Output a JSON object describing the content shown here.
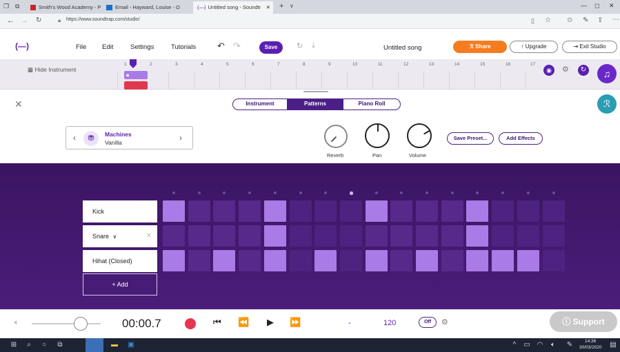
{
  "browser": {
    "tabs": [
      {
        "label": "Smith's Wood Academy - P"
      },
      {
        "label": "Email - Hayward, Louise - O"
      },
      {
        "label": "Untitled song - Soundtr"
      }
    ],
    "url": "https://www.soundtrap.com/studio/"
  },
  "header": {
    "menu": [
      "File",
      "Edit",
      "Settings",
      "Tutorials"
    ],
    "save": "Save",
    "song_title": "Untitled song",
    "share": "Share",
    "upgrade": "Upgrade",
    "exit": "Exit Studio"
  },
  "timeline": {
    "hide_instrument": "Hide Instrument",
    "ticks": [
      "1",
      "2",
      "3",
      "4",
      "5",
      "6",
      "7",
      "8",
      "9",
      "10",
      "11",
      "12",
      "13",
      "14",
      "15",
      "16",
      "17"
    ]
  },
  "editor": {
    "tabs": [
      "Instrument",
      "Patterns",
      "Piano Roll"
    ],
    "active_tab": "Patterns",
    "instrument_name": "Machines",
    "instrument_preset": "Vanilla",
    "knobs": [
      "Reverb",
      "Pan",
      "Volume"
    ],
    "save_preset": "Save Preset...",
    "add_effects": "Add Effects"
  },
  "pattern": {
    "tracks": [
      "Kick",
      "Snare",
      "Hihat (Closed)"
    ],
    "add_label": "+ Add",
    "grid": [
      [
        1,
        0,
        0,
        0,
        1,
        0,
        0,
        0,
        1,
        0,
        0,
        0,
        1,
        0,
        0,
        0
      ],
      [
        0,
        0,
        0,
        0,
        1,
        0,
        0,
        0,
        0,
        0,
        0,
        0,
        1,
        0,
        0,
        0
      ],
      [
        1,
        0,
        1,
        0,
        1,
        0,
        1,
        0,
        1,
        0,
        1,
        0,
        1,
        1,
        1,
        0
      ]
    ],
    "current_step": 7
  },
  "transport": {
    "time": "00:00.7",
    "bpm": "120",
    "separator": "-",
    "metronome": "Off",
    "support": "Support"
  },
  "taskbar": {
    "time": "14:36",
    "date": "30/03/2020"
  },
  "colors": {
    "purple": "#5b1fb0",
    "orange": "#f57c1f",
    "cell_on": "#a97be6",
    "teal": "#2a9db3"
  }
}
